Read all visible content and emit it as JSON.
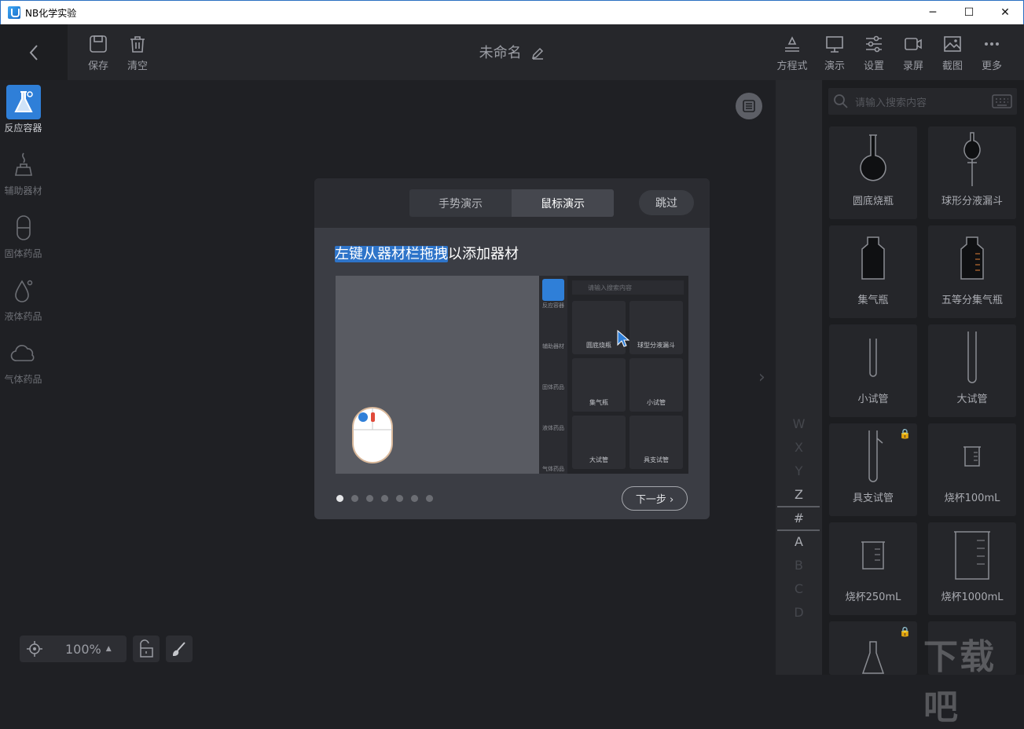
{
  "window": {
    "title": "NB化学实验",
    "minimize": "─",
    "maximize": "☐",
    "close": "✕"
  },
  "toolbar": {
    "save_label": "保存",
    "clear_label": "清空",
    "doc_title": "未命名",
    "equation_label": "方程式",
    "demo_label": "演示",
    "settings_label": "设置",
    "record_label": "录屏",
    "screenshot_label": "截图",
    "more_label": "更多"
  },
  "categories": [
    {
      "label": "反应容器",
      "icon": "flask-icon",
      "active": true
    },
    {
      "label": "辅助器材",
      "icon": "burner-icon",
      "active": false
    },
    {
      "label": "固体药品",
      "icon": "capsule-icon",
      "active": false
    },
    {
      "label": "液体药品",
      "icon": "drop-icon",
      "active": false
    },
    {
      "label": "气体药品",
      "icon": "cloud-icon",
      "active": false
    }
  ],
  "letters": [
    "W",
    "X",
    "Y",
    "Z",
    "#",
    "A",
    "B",
    "C",
    "D"
  ],
  "search": {
    "placeholder": "请输入搜索内容"
  },
  "items": [
    {
      "label": "圆底烧瓶",
      "locked": false
    },
    {
      "label": "球形分液漏斗",
      "locked": false
    },
    {
      "label": "集气瓶",
      "locked": false
    },
    {
      "label": "五等分集气瓶",
      "locked": false
    },
    {
      "label": "小试管",
      "locked": false
    },
    {
      "label": "大试管",
      "locked": false
    },
    {
      "label": "具支试管",
      "locked": true
    },
    {
      "label": "烧杯100mL",
      "locked": false
    },
    {
      "label": "烧杯250mL",
      "locked": false
    },
    {
      "label": "烧杯1000mL",
      "locked": false
    }
  ],
  "status": {
    "zoom": "100%"
  },
  "dialog": {
    "tab_gesture": "手势演示",
    "tab_mouse": "鼠标演示",
    "skip": "跳过",
    "hint_highlight": "左键从器材栏拖拽",
    "hint_rest": "以添加器材",
    "next": "下一步 ›",
    "page_count": 7,
    "current_page": 1,
    "demo": {
      "search_placeholder": "请输入搜索内容",
      "categories": [
        "反应容器",
        "辅助器材",
        "固体药品",
        "液体药品",
        "气体药品"
      ],
      "items": [
        "圆底烧瓶",
        "球型分液漏斗",
        "集气瓶",
        "小试管",
        "大试管",
        "具支试管"
      ]
    }
  },
  "watermark": "下载吧",
  "colors": {
    "accent": "#2f7fd8",
    "lock": "#b58c1c",
    "background": "#1f2024"
  }
}
